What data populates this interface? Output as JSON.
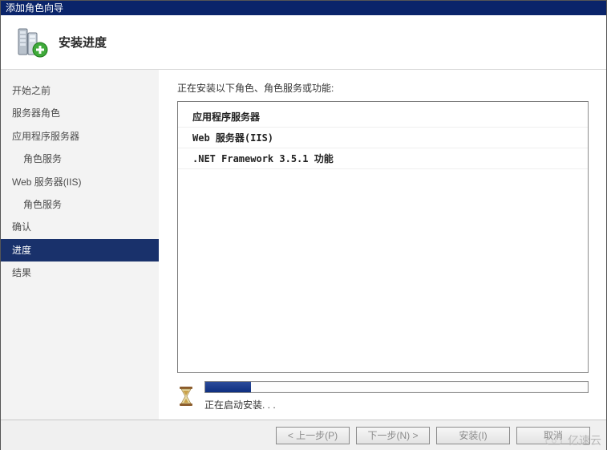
{
  "window": {
    "title": "添加角色向导"
  },
  "header": {
    "title": "安装进度"
  },
  "sidebar": {
    "items": [
      {
        "label": "开始之前",
        "indent": 0,
        "selected": false
      },
      {
        "label": "服务器角色",
        "indent": 0,
        "selected": false
      },
      {
        "label": "应用程序服务器",
        "indent": 0,
        "selected": false
      },
      {
        "label": "角色服务",
        "indent": 1,
        "selected": false
      },
      {
        "label": "Web 服务器(IIS)",
        "indent": 0,
        "selected": false
      },
      {
        "label": "角色服务",
        "indent": 1,
        "selected": false
      },
      {
        "label": "确认",
        "indent": 0,
        "selected": false
      },
      {
        "label": "进度",
        "indent": 0,
        "selected": true
      },
      {
        "label": "结果",
        "indent": 0,
        "selected": false
      }
    ]
  },
  "content": {
    "label": "正在安装以下角色、角色服务或功能:",
    "roles": [
      "应用程序服务器",
      "Web 服务器(IIS)",
      ".NET Framework 3.5.1 功能"
    ],
    "progress": {
      "percent": 12,
      "text": "正在启动安装. . ."
    }
  },
  "footer": {
    "prev": "< 上一步(P)",
    "next": "下一步(N) >",
    "install": "安装(I)",
    "cancel": "取消"
  },
  "watermark": {
    "text": "亿速云"
  }
}
